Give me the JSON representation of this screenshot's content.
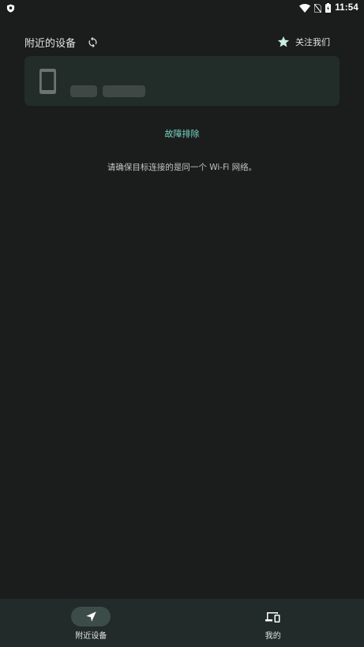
{
  "status_bar": {
    "time": "11:54",
    "icons": [
      "shield-icon",
      "wifi-icon",
      "no-sim-icon",
      "battery-charging-icon"
    ]
  },
  "header": {
    "title": "附近的设备",
    "refresh_icon": "refresh-icon",
    "follow_label": "关注我们",
    "follow_icon": "star-icon"
  },
  "device_card": {
    "icon": "phone-icon"
  },
  "troubleshoot": {
    "label": "故障排除"
  },
  "hint": {
    "text": "请确保目标连接的是同一个 Wi-Fi 网络。"
  },
  "bottom_nav": {
    "items": [
      {
        "label": "附近设备",
        "icon": "send-icon",
        "active": true
      },
      {
        "label": "我的",
        "icon": "devices-icon",
        "active": false
      }
    ]
  },
  "colors": {
    "background": "#1b1d1c",
    "accent": "#79d6c8",
    "card": "#222d2a",
    "nav_bar": "#222b29",
    "nav_active_pill": "#3c4d49"
  }
}
